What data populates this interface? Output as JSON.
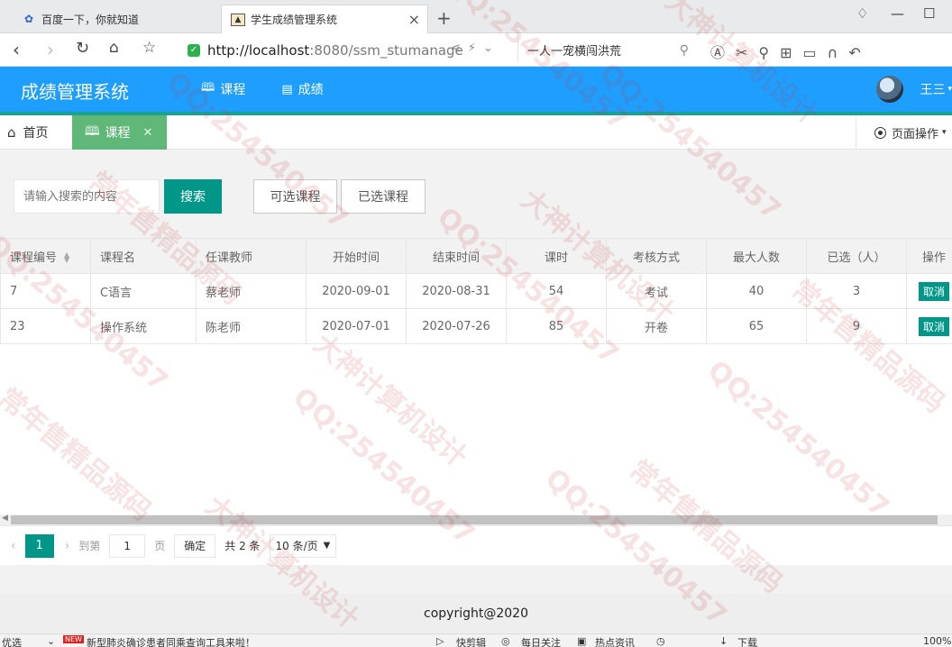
{
  "browser": {
    "tabs": [
      {
        "title": "百度一下，你就知道"
      },
      {
        "title": "学生成绩管理系统"
      }
    ],
    "url_host": "http://localhost",
    "url_rest": ":8080/ssm_stumanage",
    "search_text": "一人一宠横闯洪荒",
    "zoom": "100%"
  },
  "header": {
    "logo": "成绩管理系统",
    "nav": [
      {
        "label": "课程",
        "icon": "book-icon",
        "active": true
      },
      {
        "label": "成绩",
        "icon": "clipboard-icon",
        "active": false
      }
    ],
    "user_name": "王三"
  },
  "page_tabs": {
    "home_label": "首页",
    "current_label": "课程",
    "page_ops_label": "页面操作"
  },
  "toolbar": {
    "search_placeholder": "请输入搜索的内容",
    "search_label": "搜索",
    "optional_courses_label": "可选课程",
    "selected_courses_label": "已选课程"
  },
  "table": {
    "headers": [
      "课程编号",
      "课程名",
      "任课教师",
      "开始时间",
      "结束时间",
      "课时",
      "考核方式",
      "最大人数",
      "已选（人）",
      "操作"
    ],
    "rows": [
      {
        "id": "7",
        "name": "C语言",
        "teacher": "蔡老师",
        "start": "2020-09-01",
        "end": "2020-08-31",
        "hours": "54",
        "exam": "考试",
        "max": "40",
        "selected": "3",
        "action": "取消"
      },
      {
        "id": "23",
        "name": "操作系统",
        "teacher": "陈老师",
        "start": "2020-07-01",
        "end": "2020-07-26",
        "hours": "85",
        "exam": "开卷",
        "max": "65",
        "selected": "9",
        "action": "取消"
      }
    ]
  },
  "pager": {
    "current_page": "1",
    "goto_label": "到第",
    "goto_value": "1",
    "page_unit": "页",
    "confirm_label": "确定",
    "total_label": "共 2 条",
    "page_size_label": "10 条/页"
  },
  "footer": {
    "copyright": "copyright@2020"
  },
  "statusbar": {
    "items": [
      "优选",
      "新型肺炎确诊患者同乘查询工具来啦！",
      "快剪辑",
      "每日关注",
      "热点资讯",
      "下载"
    ]
  },
  "watermark": {
    "texts": [
      "QQ:254540457",
      "大神计算机设计",
      "常年售精品源码"
    ]
  },
  "colors": {
    "header_blue": "#1e9fff",
    "primary_teal": "#009688",
    "tab_green": "#5fb878"
  }
}
